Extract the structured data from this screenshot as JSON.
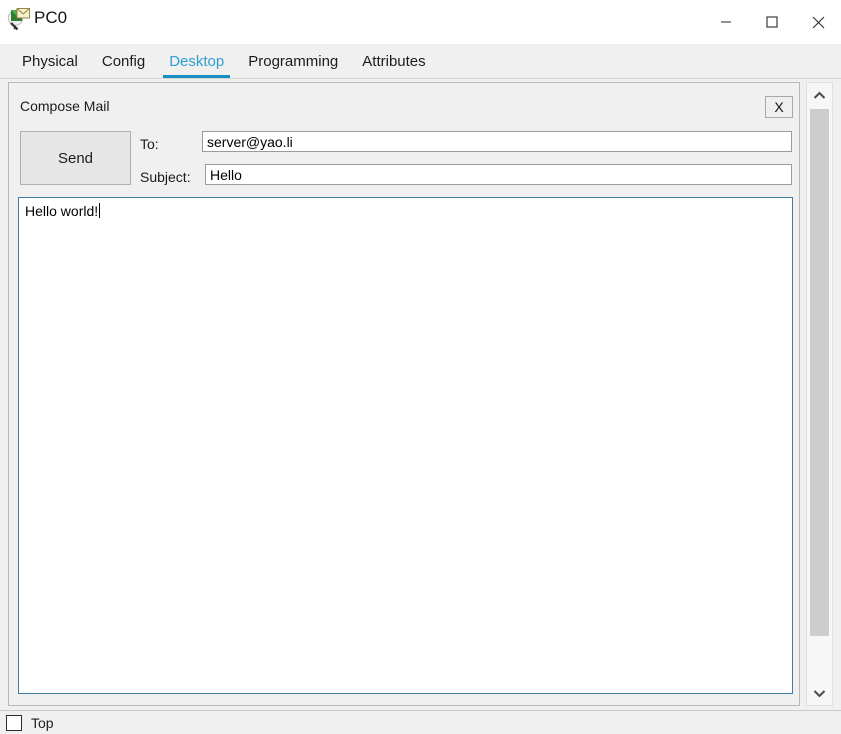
{
  "window": {
    "title": "PC0",
    "icon": "pc-mail-magnifier-icon",
    "controls": {
      "minimize": "minimize-icon",
      "maximize": "maximize-icon",
      "close": "close-icon"
    }
  },
  "tabs": [
    {
      "label": "Physical",
      "active": false
    },
    {
      "label": "Config",
      "active": false
    },
    {
      "label": "Desktop",
      "active": true
    },
    {
      "label": "Programming",
      "active": false
    },
    {
      "label": "Attributes",
      "active": false
    }
  ],
  "panel": {
    "title": "Compose Mail",
    "close_label": "X",
    "send_label": "Send",
    "fields": {
      "to_label": "To:",
      "to_value": "server@yao.li",
      "to_placeholder": "",
      "subject_label": "Subject:",
      "subject_value": "Hello",
      "subject_placeholder": ""
    },
    "body_value": "Hello world!",
    "body_placeholder": ""
  },
  "scrollbar": {
    "up_icon": "chevron-up-icon",
    "down_icon": "chevron-down-icon"
  },
  "statusbar": {
    "top_label": "Top",
    "top_checked": false
  },
  "colors": {
    "accent": "#1a8fc4",
    "tab_active_text": "#2f9fd0",
    "panel_bg": "#f0f0f0",
    "field_border": "#9b9b9b",
    "body_border": "#3f7fa5",
    "scroll_thumb": "#cdcdcd"
  }
}
